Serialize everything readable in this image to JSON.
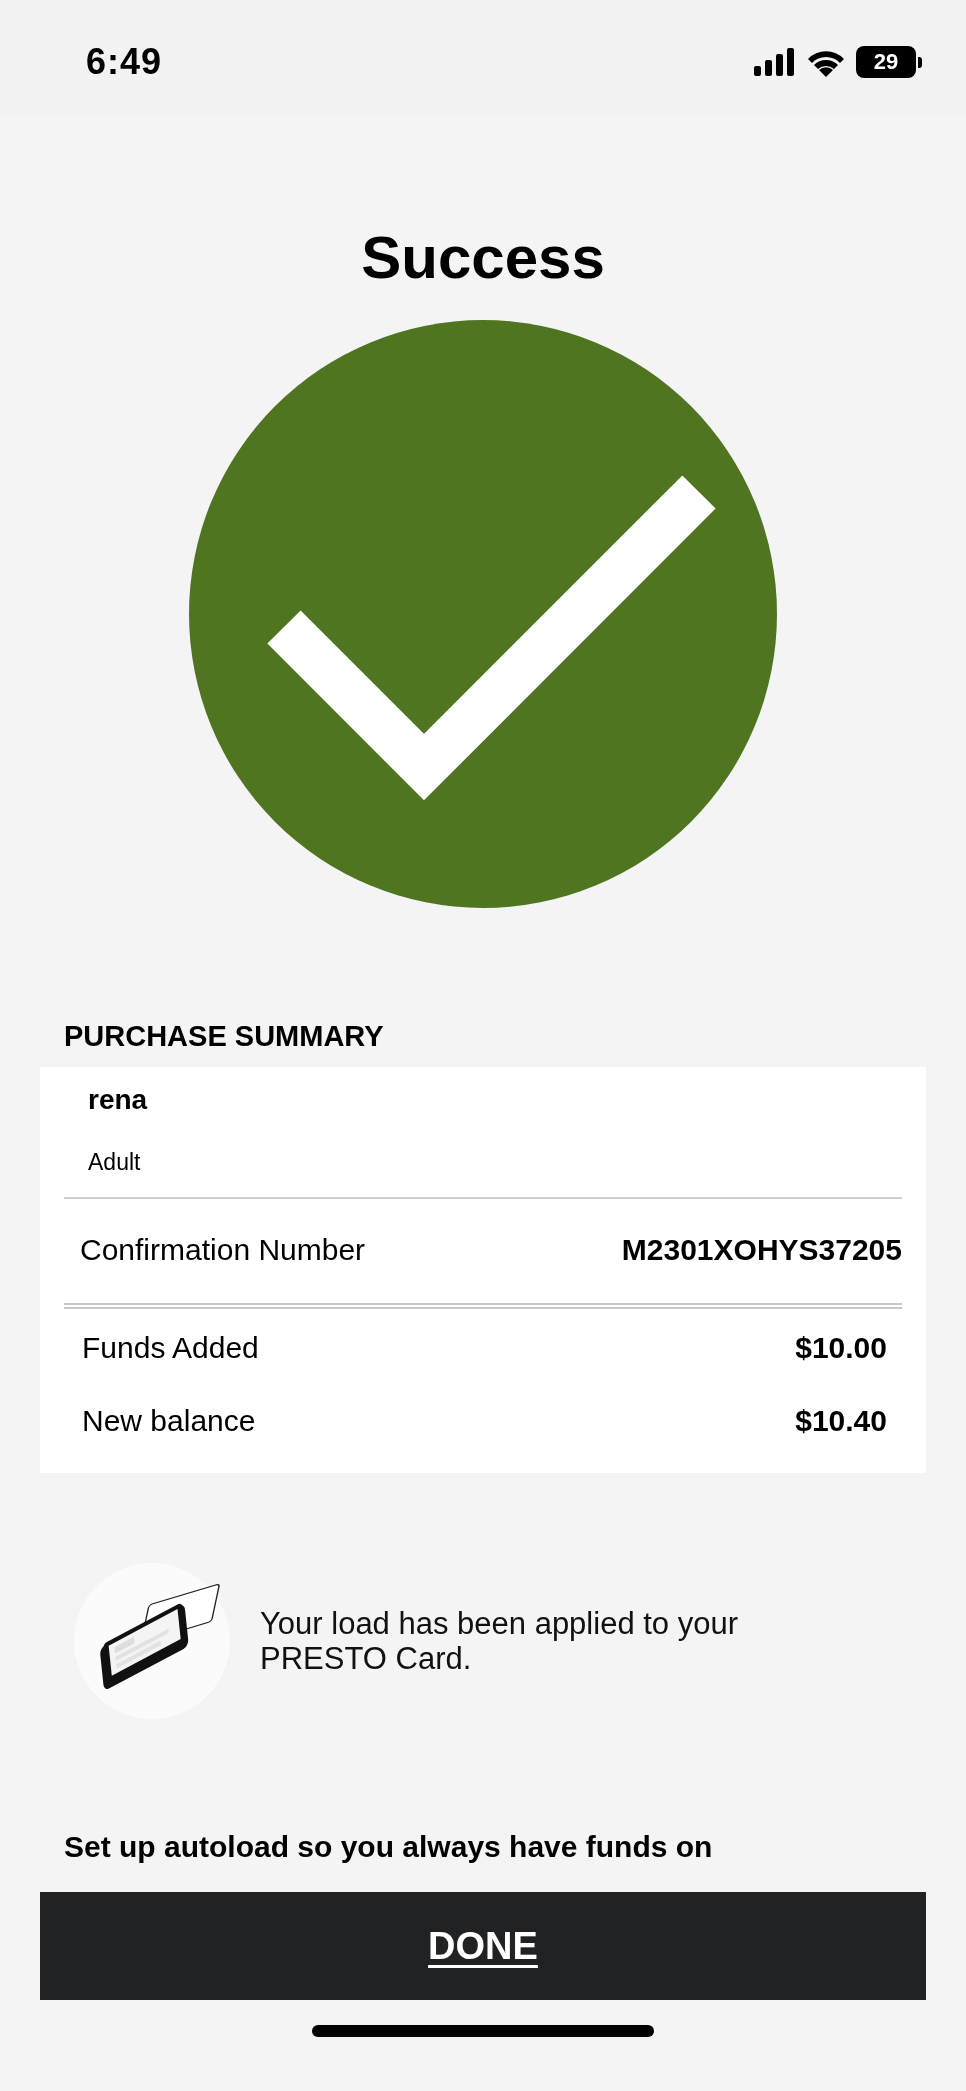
{
  "status_bar": {
    "time": "6:49",
    "battery": "29"
  },
  "title": "Success",
  "summary": {
    "heading": "PURCHASE SUMMARY",
    "name": "rena",
    "type": "Adult",
    "confirmation": {
      "label": "Confirmation Number",
      "value": "M2301XOHYS37205"
    },
    "rows": [
      {
        "label": "Funds Added",
        "value": "$10.00"
      },
      {
        "label": "New balance",
        "value": "$10.40"
      }
    ]
  },
  "notice": {
    "text": "Your load has been applied to your PRESTO Card."
  },
  "autoload": {
    "text": "Set up autoload so you always have funds on"
  },
  "done_button": {
    "label": "DONE"
  }
}
